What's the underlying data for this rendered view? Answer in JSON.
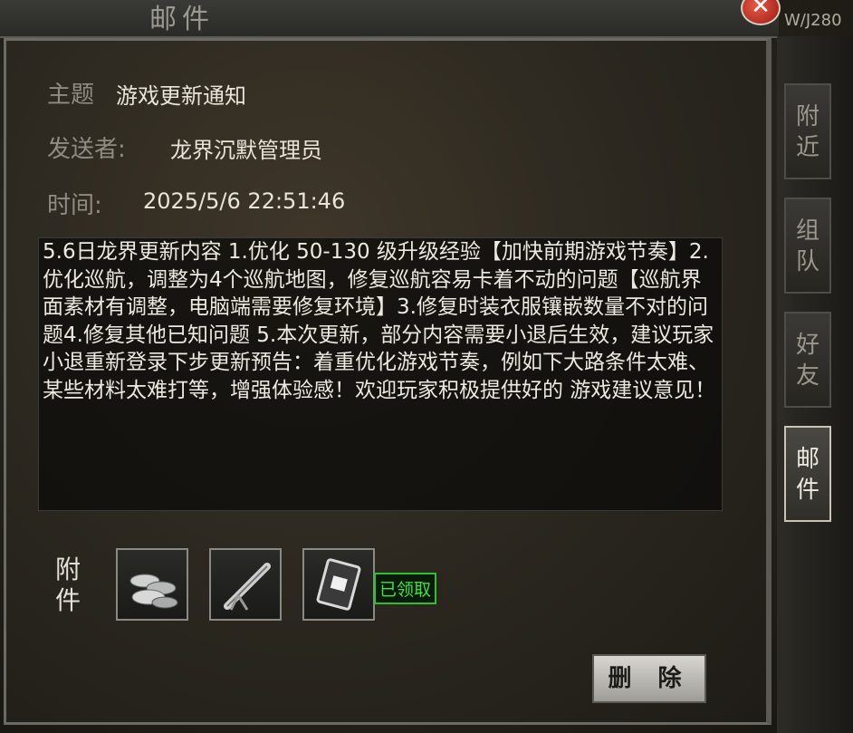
{
  "window": {
    "title": "邮件",
    "close": "✕",
    "server_tag": "W/J280"
  },
  "mail": {
    "subject_label": "主题",
    "subject": "游戏更新通知",
    "sender_label": "发送者:",
    "sender": "龙界沉默管理员",
    "time_label": "时间:",
    "time": "2025/5/6 22:51:46",
    "body": "5.6日龙界更新内容 1.优化 50-130 级升级经验【加快前期游戏节奏】2.优化巡航，调整为4个巡航地图，修复巡航容易卡着不动的问题【巡航界面素材有调整，电脑端需要修复环境】3.修复时装衣服镶嵌数量不对的问题4.修复其他已知问题 5.本次更新，部分内容需要小退后生效，建议玩家小退重新登录下步更新预告：着重优化游戏节奏，例如下大路条件太难、某些材料太难打等，增强体验感！欢迎玩家积极提供好的 游戏建议意见！"
  },
  "attachments": {
    "label": "附件",
    "items": [
      {
        "icon": "silver-ingots-icon"
      },
      {
        "icon": "telescope-icon"
      },
      {
        "icon": "card-icon"
      }
    ],
    "claimed_badge": "已领取"
  },
  "actions": {
    "delete_label": "删 除"
  },
  "side_tabs": [
    {
      "label": "附近",
      "active": false
    },
    {
      "label": "组队",
      "active": false
    },
    {
      "label": "好友",
      "active": false
    },
    {
      "label": "邮件",
      "active": true
    }
  ],
  "colors": {
    "claimed_green": "#43e043",
    "panel_bg": "#2c2820",
    "text": "#e8e4da"
  }
}
